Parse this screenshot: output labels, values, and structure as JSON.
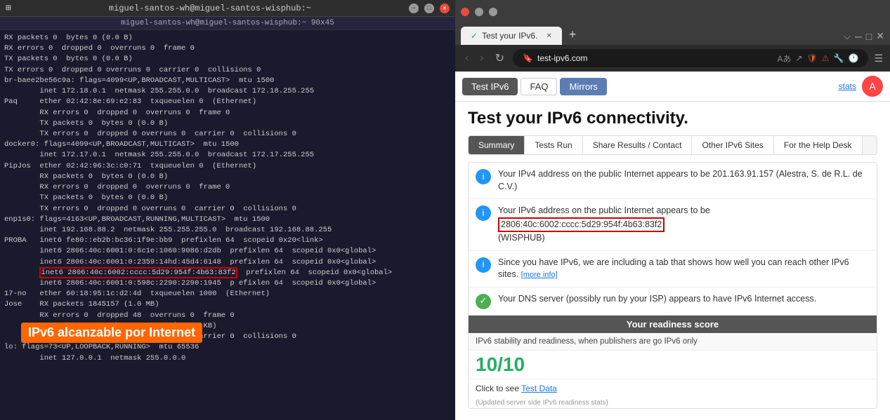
{
  "terminal": {
    "titlebar": "miguel-santos-wh@miguel-santos-wisphub:~",
    "subtitle": "miguel-santos-wh@miguel-santos-wisphub:~ 90x45",
    "lines": [
      "RX packets 0  bytes 0 (0.0 B)",
      "RX errors 0  dropped 0  overruns 0  frame 0",
      "TX packets 0  bytes 0 (0.0 B)",
      "TX errors 0  dropped 0 overruns 0  carrier 0  collisions 0",
      "",
      "br-baee2be56c9a: flags=4099<UP,BROADCAST,MULTICAST>  mtu 1500",
      "        inet 172.18.0.1  netmask 255.255.0.0  broadcast 172.18.255.255",
      "Paq     ether 02:42:8e:69:e2:83  txqueuelen 0  (Ethernet)",
      "        RX errors 0  dropped 0  overruns 0  frame 0",
      "        TX packets 0  bytes 0 (0.0 B)",
      "        TX errors 0  dropped 0 overruns 0  carrier 0  collisions 0",
      "",
      "docker0: flags=4099<UP,BROADCAST,MULTICAST>  mtu 1500",
      "        inet 172.17.0.1  netmask 255.255.0.0  broadcast 172.17.255.255",
      "PipJos  ether 02:42:96:3c:c0:71  txqueuelen 0  (Ethernet)",
      "        RX packets 0  bytes 0 (0.0 B)",
      "        RX errors 0  dropped 0  overruns 0  frame 0",
      "        TX packets 0  bytes 0 (0.0 B)",
      "        TX errors 0  dropped 0 overruns 0  carrier 0  collisions 0",
      "",
      "enp1s0: flags=4163<UP,BROADCAST,RUNNING,MULTICAST>  mtu 1500",
      "        inet 192.168.88.2  netmask 255.255.255.0  broadcast 192.168.88.255",
      "PROBA   inet6 fe80::eb2b:bc36:1f9e:bb9  prefixlen 64  scopeid 0x20<link>",
      "        inet6 2806:40c:6001:0:6c1e:1060:9086:d2db  prefixlen 64  scopeid 0x0<global>",
      "        inet6 2806:40c:6001:0:2359:14hd:45d4:6148  prefixlen 64  scopeid 0x0<global>",
      "        inet6 2806:40c:6002:cccc:5d29:954f:4b63:83f2  prefixlen 64  scopeid 0x0<global>",
      "        inet6 2806:40c:6001:0:598c:2290:2290:1945  p efixlen 64  scopeid 0x0<global>",
      "17-no   ether 60:18:95:1c:d2:4d  txqueuelen 1000  (Ethernet)",
      "Jose    RX packets 1845157 (1.0 MB)",
      "        RX errors 0  dropped 48  overruns 0  frame 0",
      "        TX packets 1853  bytes 305188 (305.1 KB)",
      "        TX errors 8  dropped 0 overruns 0  carrier 0  collisions 0",
      "",
      "lo: flags=73<UP,LOOPBACK,RUNNING>  mtu 65536",
      "        inet 127.0.0.1  netmask 255.0.0.0"
    ],
    "highlighted_line": "inet6 2806:40c:6002:cccc:5d29:954f:4b63:83f2",
    "ipv6_label": "IPv6 alcanzable por Internet"
  },
  "browser": {
    "tab_title": "Test your IPv6.",
    "url": "test-ipv6.com",
    "nav": {
      "test_ipv6": "Test IPv6",
      "faq": "FAQ",
      "mirrors": "Mirrors",
      "stats": "stats"
    },
    "page_title": "Test your IPv6 connectivity.",
    "tabs": {
      "summary": "Summary",
      "tests_run": "Tests Run",
      "share": "Share Results / Contact",
      "other_sites": "Other IPv6 Sites",
      "help_desk": "For the Help Desk"
    },
    "results": [
      {
        "type": "info",
        "text": "Your IPv4 address on the public Internet appears to be 201.163.91.157 (Alestra, S. de R.L. de C.V.)"
      },
      {
        "type": "info",
        "text": "Your IPv6 address on the public Internet appears to be",
        "ipv6": "2806:40c:6002:cccc:5d29:954f:4b63:83f2",
        "suffix": "(WISPHUB)"
      },
      {
        "type": "info",
        "text": "Since you have IPv6, we are including a tab that shows how well you can reach other IPv6 sites.",
        "more_info": "more info"
      },
      {
        "type": "check",
        "text": "Your DNS server (possibly run by your ISP) appears to have IPv6 Internet access."
      }
    ],
    "readiness": {
      "label": "Your readiness score",
      "sub_text": "IPv6 stability and readiness, when publishers are go IPv6 only",
      "score": "10/10"
    },
    "test_data_link": "Test Data",
    "updated_note": "(Updated server side IPv6 readiness stats)"
  }
}
